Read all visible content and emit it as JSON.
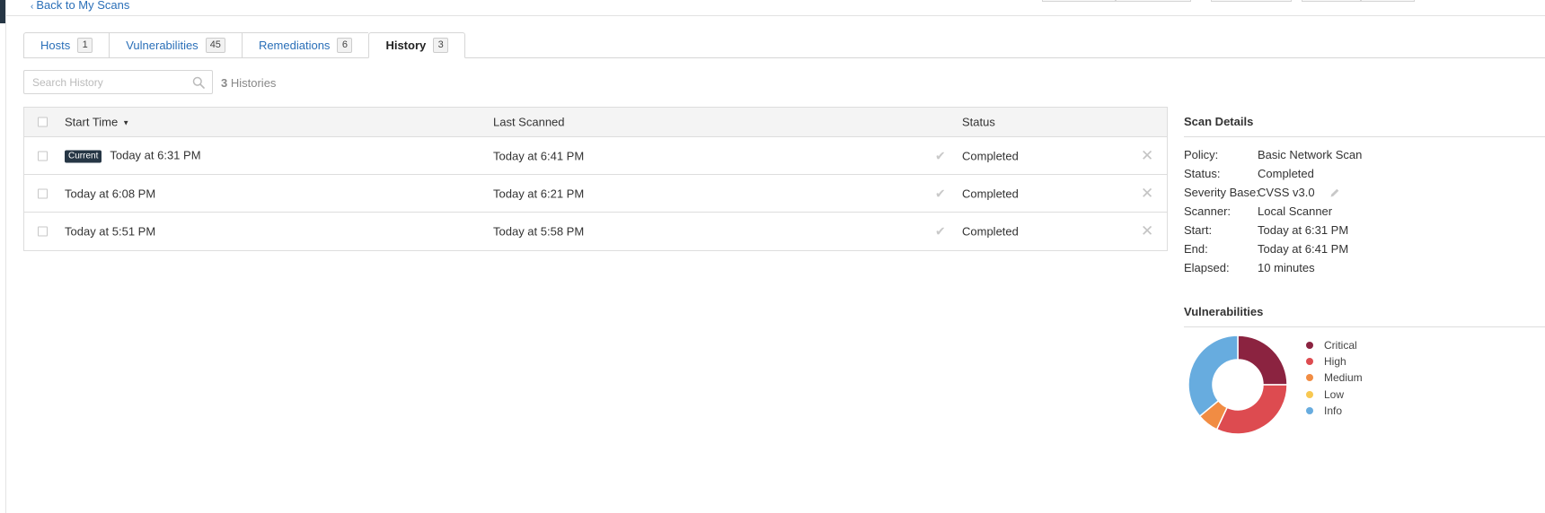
{
  "nav": {
    "back_label": "Back to My Scans"
  },
  "tabs": [
    {
      "label": "Hosts",
      "count": "1",
      "active": false
    },
    {
      "label": "Vulnerabilities",
      "count": "45",
      "active": false
    },
    {
      "label": "Remediations",
      "count": "6",
      "active": false
    },
    {
      "label": "History",
      "count": "3",
      "active": true
    }
  ],
  "search": {
    "placeholder": "Search History",
    "value": ""
  },
  "summary": {
    "count": "3",
    "label": "Histories"
  },
  "table": {
    "headers": {
      "start_time": "Start Time",
      "last_scanned": "Last Scanned",
      "status": "Status"
    },
    "rows": [
      {
        "badge": "Current",
        "start": "Today at 6:31 PM",
        "last": "Today at 6:41 PM",
        "status": "Completed"
      },
      {
        "badge": "",
        "start": "Today at 6:08 PM",
        "last": "Today at 6:21 PM",
        "status": "Completed"
      },
      {
        "badge": "",
        "start": "Today at 5:51 PM",
        "last": "Today at 5:58 PM",
        "status": "Completed"
      }
    ]
  },
  "scan_details": {
    "title": "Scan Details",
    "rows": [
      {
        "key": "Policy:",
        "value": "Basic Network Scan"
      },
      {
        "key": "Status:",
        "value": "Completed"
      },
      {
        "key": "Severity Base:",
        "value": "CVSS v3.0"
      },
      {
        "key": "Scanner:",
        "value": "Local Scanner"
      },
      {
        "key": "Start:",
        "value": "Today at 6:31 PM"
      },
      {
        "key": "End:",
        "value": "Today at 6:41 PM"
      },
      {
        "key": "Elapsed:",
        "value": "10 minutes"
      }
    ]
  },
  "vulnerabilities": {
    "title": "Vulnerabilities",
    "legend": [
      {
        "label": "Critical",
        "color": "#8b2340"
      },
      {
        "label": "High",
        "color": "#dd4b50"
      },
      {
        "label": "Medium",
        "color": "#f18c43"
      },
      {
        "label": "Low",
        "color": "#f8c851"
      },
      {
        "label": "Info",
        "color": "#67acdf"
      }
    ]
  },
  "chart_data": {
    "type": "pie",
    "categories": [
      "Critical",
      "High",
      "Medium",
      "Low",
      "Info"
    ],
    "values": [
      25,
      32,
      7,
      0,
      36
    ],
    "colors": [
      "#8b2340",
      "#dd4b50",
      "#f18c43",
      "#f8c851",
      "#67acdf"
    ]
  }
}
